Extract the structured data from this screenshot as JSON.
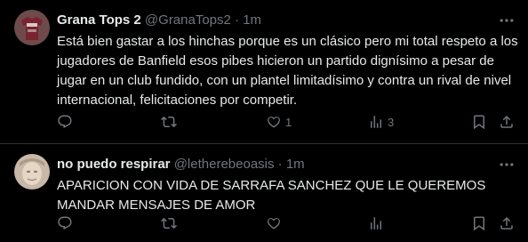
{
  "tweets": [
    {
      "display_name": "Grana Tops 2",
      "handle": "@GranaTops2",
      "separator": "·",
      "time": "1m",
      "text": "Está bien gastar a los hinchas porque es un clásico pero mi total respeto a los jugadores de Banfield esos pibes hicieron un partido dignísimo a pesar de jugar en un club fundido, con un plantel limitadísimo y contra un rival de nivel internacional, felicitaciones por competir.",
      "counts": {
        "replies": "",
        "retweets": "",
        "likes": "1",
        "views": "3"
      }
    },
    {
      "display_name": "no puedo respirar",
      "handle": "@letherebeoasis",
      "separator": "·",
      "time": "1m",
      "text": "APARICION CON VIDA DE SARRAFA SANCHEZ QUE LE QUEREMOS MANDAR MENSAJES DE AMOR",
      "counts": {
        "replies": "",
        "retweets": "",
        "likes": "",
        "views": ""
      }
    }
  ],
  "icons": {
    "more": "more-dots-icon",
    "reply": "reply-icon",
    "retweet": "retweet-icon",
    "like": "heart-icon",
    "views": "views-bar-icon",
    "bookmark": "bookmark-icon",
    "share": "share-icon"
  },
  "colors": {
    "background": "#000000",
    "text": "#e7e9ea",
    "secondary": "#71767b",
    "divider": "#2f3336"
  }
}
